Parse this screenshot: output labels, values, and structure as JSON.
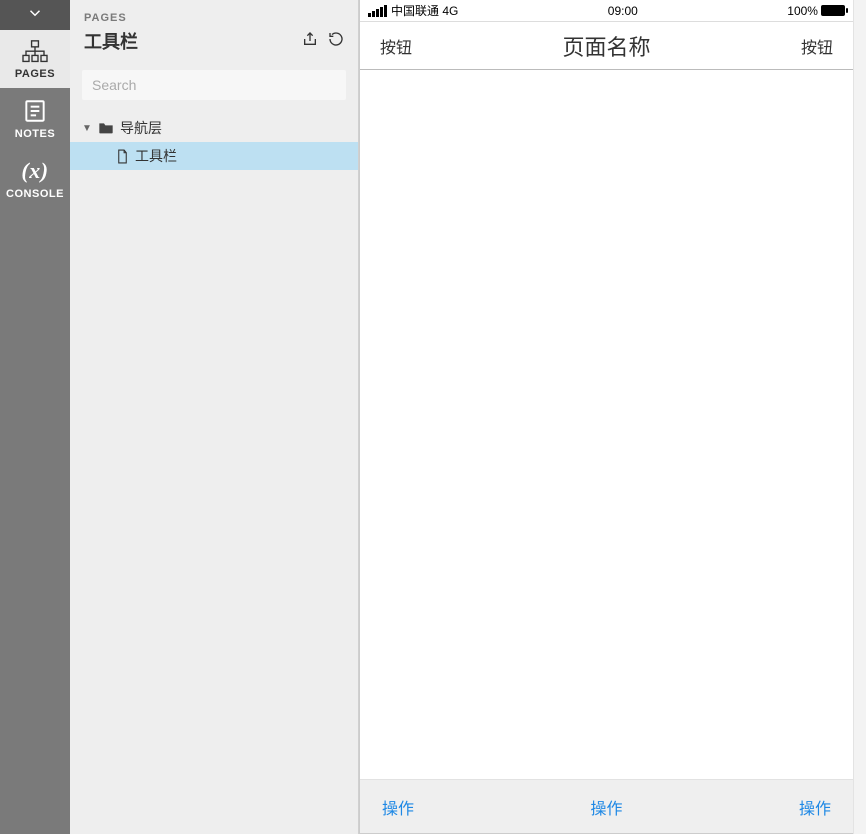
{
  "rail": {
    "items": [
      {
        "label": "PAGES"
      },
      {
        "label": "NOTES"
      },
      {
        "label": "CONSOLE"
      }
    ]
  },
  "sidebar": {
    "eyebrow": "PAGES",
    "title": "工具栏",
    "search_placeholder": "Search",
    "tree": {
      "folder_label": "导航层",
      "page_label": "工具栏"
    }
  },
  "phone": {
    "status": {
      "carrier": "中国联通 4G",
      "time": "09:00",
      "battery": "100%"
    },
    "navbar": {
      "left": "按钮",
      "title": "页面名称",
      "right": "按钮"
    },
    "tabbar": {
      "items": [
        "操作",
        "操作",
        "操作"
      ]
    }
  }
}
